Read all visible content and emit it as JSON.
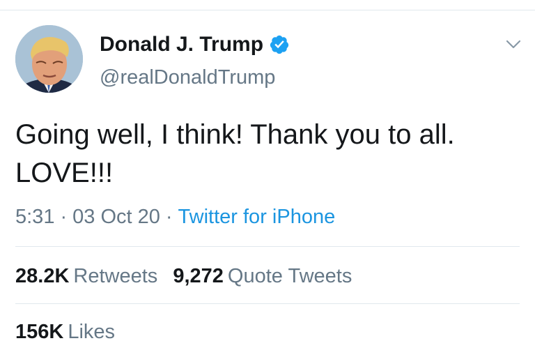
{
  "tweet": {
    "author": {
      "display_name": "Donald J. Trump",
      "handle": "@realDonaldTrump",
      "verified": true
    },
    "text": "Going well, I think! Thank you to all. LOVE!!!",
    "time": "5:31",
    "date": "03 Oct 20",
    "source": "Twitter for iPhone",
    "separator": "·"
  },
  "stats": {
    "retweets": {
      "count": "28.2K",
      "label": "Retweets"
    },
    "quote_tweets": {
      "count": "9,272",
      "label": "Quote Tweets"
    },
    "likes": {
      "count": "156K",
      "label": "Likes"
    }
  },
  "icons": {
    "verified": "verified-badge-icon",
    "menu": "chevron-down-icon"
  },
  "colors": {
    "text": "#14171a",
    "secondary": "#657786",
    "link": "#1b95e0",
    "verified": "#1da1f2",
    "divider": "#e1e8ed"
  }
}
